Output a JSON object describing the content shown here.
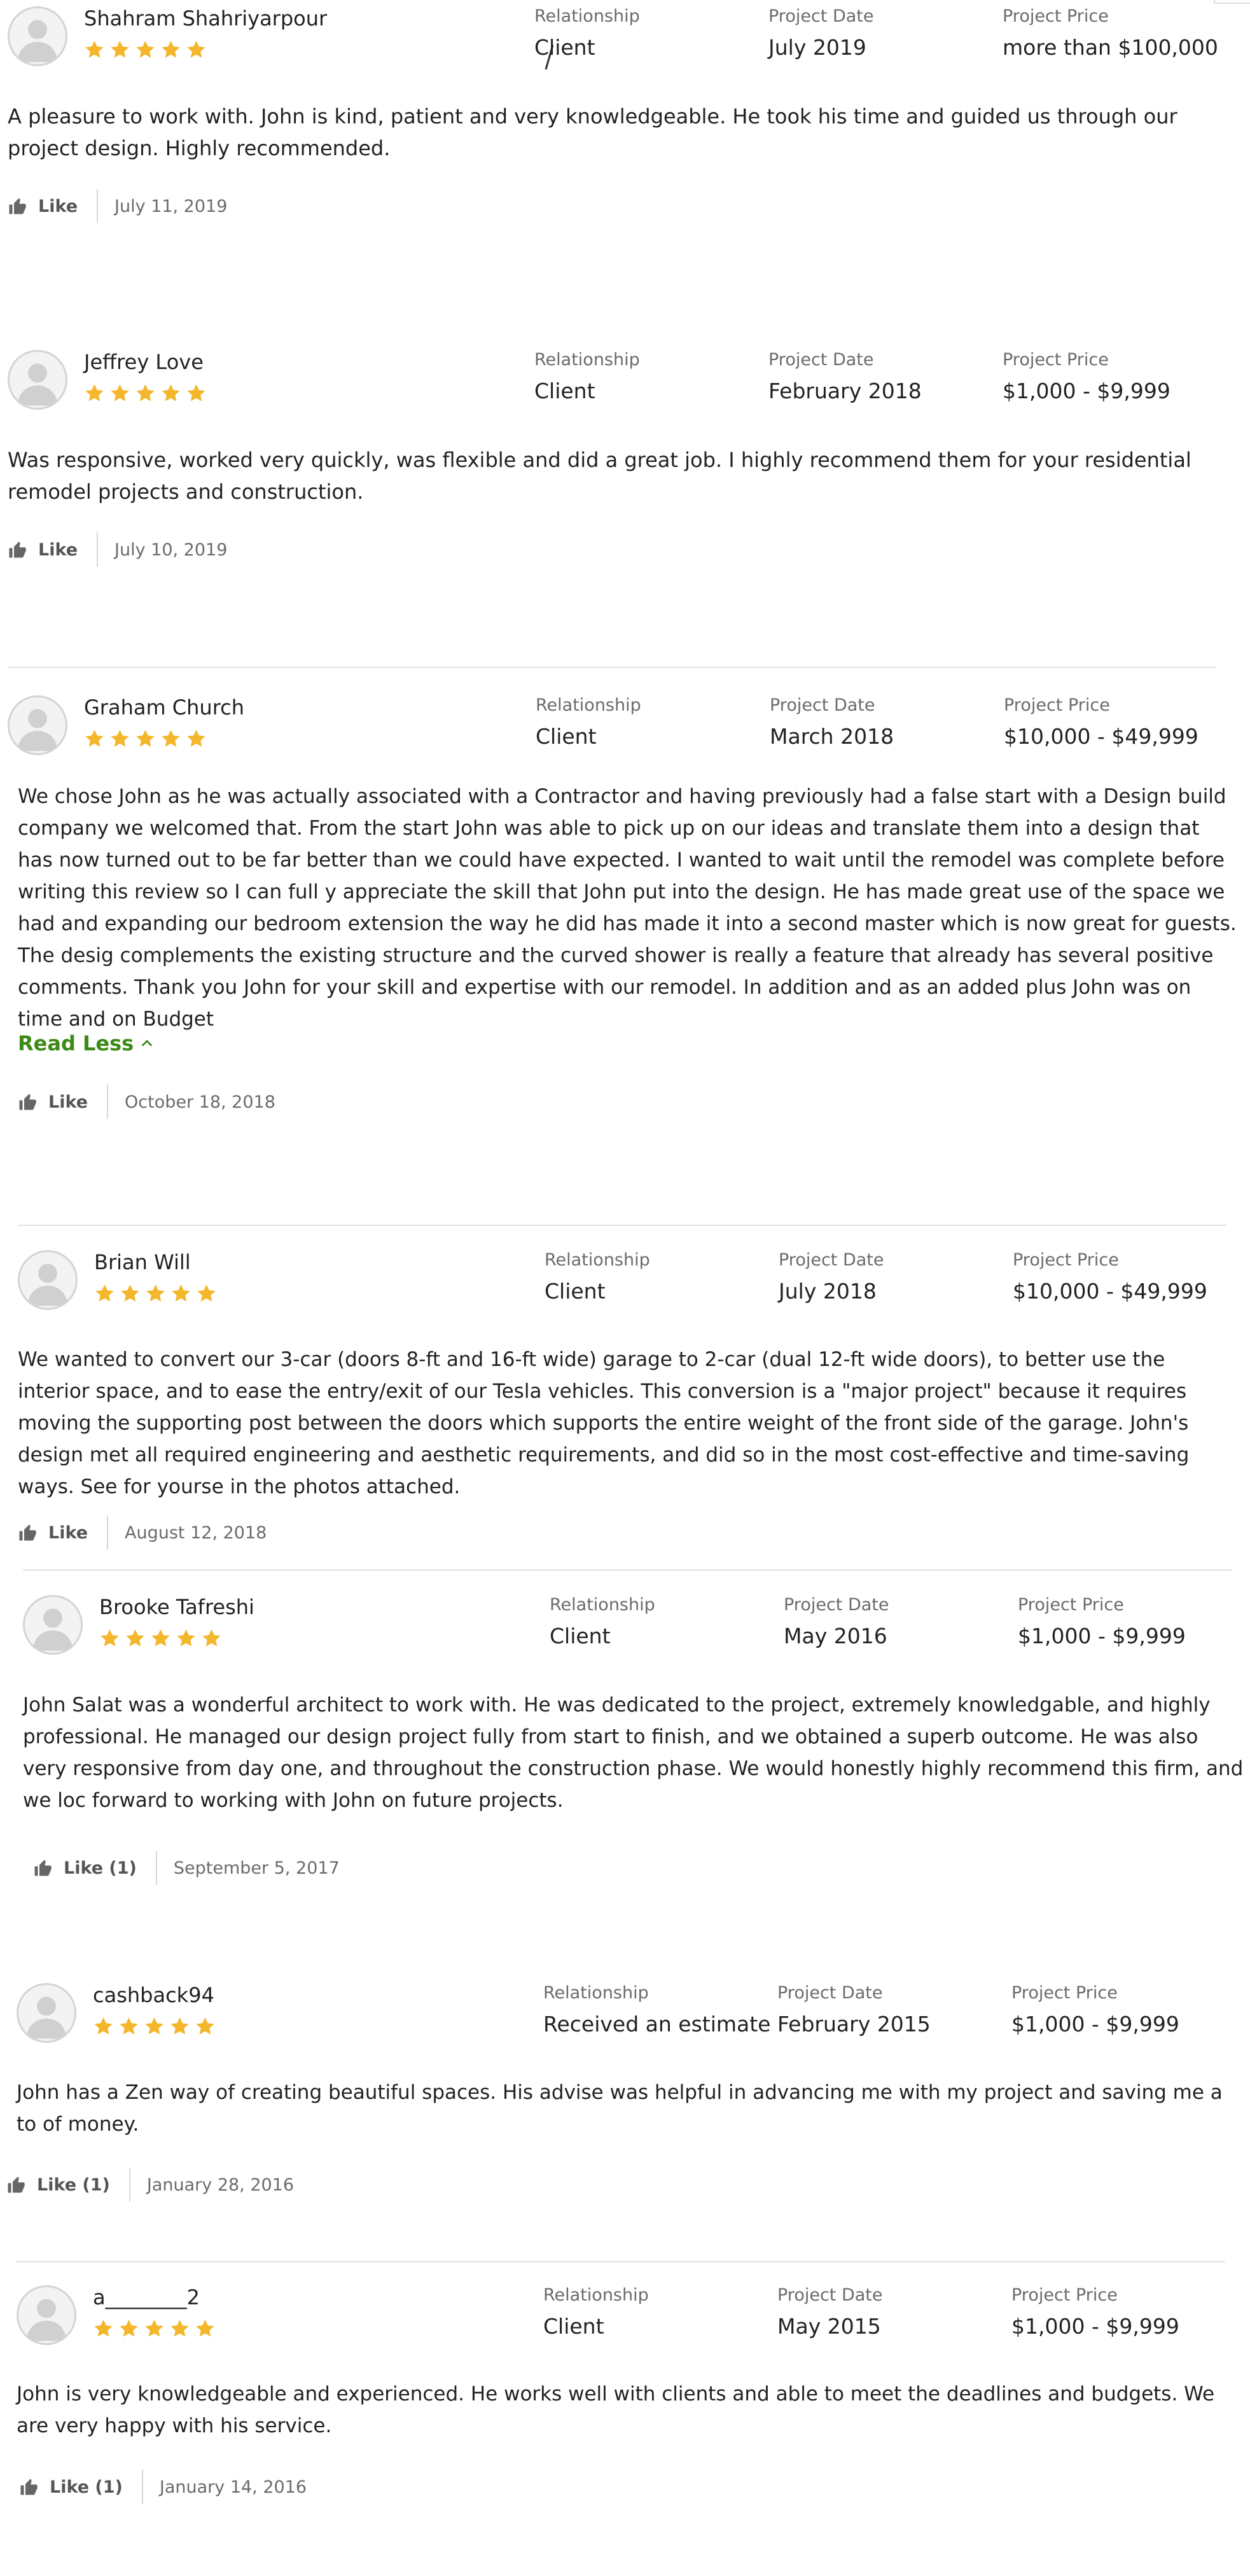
{
  "labels": {
    "relationship": "Relationship",
    "project_date": "Project Date",
    "project_price": "Project Price",
    "read_less": "Read Less"
  },
  "colors": {
    "star": "#F4B62A",
    "link_green": "#3D8A16",
    "divider": "#E1E1E1"
  },
  "reviews": [
    {
      "name": "Shahram Shahriyarpour",
      "rating": 5,
      "relationship": "Client",
      "project_date": "July 2019",
      "project_price": "more than $100,000",
      "body": "A pleasure to work with. John is kind, patient and very knowledgeable. He took his time and guided us through our project design. Highly recommended.",
      "like": "Like",
      "date": "July 11, 2019"
    },
    {
      "name": "Jeffrey Love",
      "rating": 5,
      "relationship": "Client",
      "project_date": "February 2018",
      "project_price": "$1,000 - $9,999",
      "body": "Was responsive, worked very quickly, was flexible and did a great job. I highly recommend them for your residential remodel projects and construction.",
      "like": "Like",
      "date": "July 10, 2019"
    },
    {
      "name": "Graham Church",
      "rating": 5,
      "relationship": "Client",
      "project_date": "March 2018",
      "project_price": "$10,000 - $49,999",
      "body": "We chose John as he was actually associated with a Contractor and having previously had a false start with a Design build company we welcomed that. From the start John was able to pick up on our ideas and translate them into a design that has now turned out to be far better than we could have expected. I wanted to wait until the remodel was complete before writing this review so I can full y appreciate the skill that John put into the design. He has made great use of the space we had and expanding our bedroom extension the way he did has made it into a second master which is now great for guests. The desig complements the existing structure and the curved shower is really a feature that already has several positive comments. Thank you John for your skill and expertise with our remodel. In addition and as an added plus John was on time and on Budget",
      "like": "Like",
      "date": "October 18, 2018"
    },
    {
      "name": "Brian Will",
      "rating": 5,
      "relationship": "Client",
      "project_date": "July 2018",
      "project_price": "$10,000 - $49,999",
      "body": "We wanted to convert our 3-car (doors 8-ft and 16-ft wide) garage to 2-car (dual 12-ft wide doors), to better use the interior space, and to ease the entry/exit of our Tesla vehicles. This conversion is a \"major project\" because it requires moving the supporting post between the doors which supports the entire weight of the front side of the garage. John's design met all required engineering and aesthetic requirements, and did so in the most cost-effective and time-saving ways. See for yourse in the photos attached.",
      "like": "Like",
      "date": "August 12, 2018"
    },
    {
      "name": "Brooke Tafreshi",
      "rating": 5,
      "relationship": "Client",
      "project_date": "May 2016",
      "project_price": "$1,000 - $9,999",
      "body": "John Salat was a wonderful architect to work with. He was dedicated to the project, extremely knowledgable, and highly professional. He managed our design project fully from start to finish, and we obtained a superb outcome. He was also very responsive from day one, and throughout the construction phase. We would honestly highly recommend this firm, and we loc forward to working with John on future projects.",
      "like": "Like (1)",
      "date": "September 5, 2017"
    },
    {
      "name": "cashback94",
      "rating": 5,
      "relationship": "Received an estimate",
      "project_date": "February 2015",
      "project_price": "$1,000 - $9,999",
      "body": "John has a Zen way of creating beautiful spaces. His advise was helpful in advancing me with my project and saving me a to of money.",
      "like": "Like (1)",
      "date": "January 28, 2016"
    },
    {
      "name": "a________2",
      "rating": 5,
      "relationship": "Client",
      "project_date": "May 2015",
      "project_price": "$1,000 - $9,999",
      "body": "John is very knowledgeable and experienced. He works well with clients and able to meet the deadlines and budgets. We are very happy with his service.",
      "like": "Like (1)",
      "date": "January 14, 2016"
    }
  ]
}
